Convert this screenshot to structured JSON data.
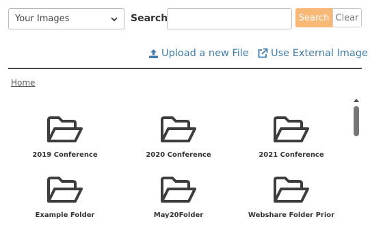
{
  "toolbar": {
    "source_select": {
      "selected": "Your Images",
      "icon": "chevron-down-icon"
    },
    "search_label": "Search",
    "search_input": {
      "value": "",
      "placeholder": ""
    },
    "search_button": "Search",
    "clear_button": "Clear"
  },
  "actions": {
    "upload": {
      "label": "Upload a new File",
      "icon": "upload-icon"
    },
    "external": {
      "label": "Use External Image",
      "icon": "external-link-icon"
    }
  },
  "breadcrumb": {
    "home": "Home"
  },
  "folders": [
    {
      "name": "2019 Conference"
    },
    {
      "name": "2020 Conference"
    },
    {
      "name": "2021 Conference"
    },
    {
      "name": "Example Folder"
    },
    {
      "name": "May20Folder"
    },
    {
      "name": "Webshare Folder Prior"
    }
  ],
  "colors": {
    "accent_link": "#3f7cac",
    "search_button": "#f8b876",
    "folder_icon": "#3d3d3d"
  }
}
